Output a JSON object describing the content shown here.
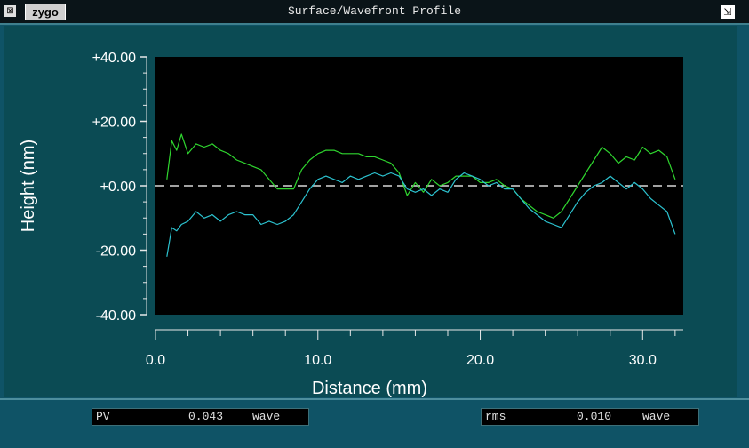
{
  "window": {
    "title": "Surface/Wavefront Profile",
    "logo": "zygo",
    "close_glyph": "⊠",
    "dock_glyph": "⇲"
  },
  "chart_data": {
    "type": "line",
    "title": "",
    "xlabel": "Distance (mm)",
    "ylabel": "Height (nm)",
    "xlim": [
      0,
      32.5
    ],
    "ylim": [
      -40,
      40
    ],
    "x_ticks": [
      0,
      10,
      20,
      30
    ],
    "x_tick_labels": [
      "0.0",
      "10.0",
      "20.0",
      "30.0"
    ],
    "y_ticks": [
      40,
      20,
      0,
      -20,
      -40
    ],
    "y_tick_labels": [
      "+40.00",
      "+20.00",
      "+0.00",
      "-20.00",
      "-40.00"
    ],
    "grid": false,
    "background": "#000000",
    "reference_line": {
      "y": 0,
      "style": "dashed",
      "color": "#d8d8d8"
    },
    "series": [
      {
        "color": "#2fd62f",
        "x": [
          0.7,
          1.0,
          1.3,
          1.6,
          2.0,
          2.5,
          3.0,
          3.5,
          4.0,
          4.5,
          5.0,
          5.5,
          6.0,
          6.5,
          7.0,
          7.5,
          8.0,
          8.5,
          9.0,
          9.5,
          10.0,
          10.5,
          11.0,
          11.5,
          12.0,
          12.5,
          13.0,
          13.5,
          14.0,
          14.5,
          15.0,
          15.5,
          16.0,
          16.5,
          17.0,
          17.5,
          18.0,
          18.5,
          19.0,
          19.5,
          20.0,
          20.5,
          21.0,
          21.5,
          22.0,
          22.5,
          23.0,
          23.5,
          24.0,
          24.5,
          25.0,
          25.5,
          26.0,
          26.5,
          27.0,
          27.5,
          28.0,
          28.5,
          29.0,
          29.5,
          30.0,
          30.5,
          31.0,
          31.5,
          32.0
        ],
        "values": [
          2,
          14,
          11,
          16,
          10,
          13,
          12,
          13,
          11,
          10,
          8,
          7,
          6,
          5,
          2,
          -1,
          -1,
          -1,
          5,
          8,
          10,
          11,
          11,
          10,
          10,
          10,
          9,
          9,
          8,
          7,
          4,
          -3,
          1,
          -2,
          2,
          0,
          1,
          3,
          3,
          3,
          1,
          1,
          2,
          0,
          -1,
          -4,
          -6,
          -8,
          -9,
          -10,
          -8,
          -4,
          0,
          4,
          8,
          12,
          10,
          7,
          9,
          8,
          12,
          10,
          11,
          9,
          2
        ]
      },
      {
        "color": "#2cc2cf",
        "x": [
          0.7,
          1.0,
          1.3,
          1.6,
          2.0,
          2.5,
          3.0,
          3.5,
          4.0,
          4.5,
          5.0,
          5.5,
          6.0,
          6.5,
          7.0,
          7.5,
          8.0,
          8.5,
          9.0,
          9.5,
          10.0,
          10.5,
          11.0,
          11.5,
          12.0,
          12.5,
          13.0,
          13.5,
          14.0,
          14.5,
          15.0,
          15.5,
          16.0,
          16.5,
          17.0,
          17.5,
          18.0,
          18.5,
          19.0,
          19.5,
          20.0,
          20.5,
          21.0,
          21.5,
          22.0,
          22.5,
          23.0,
          23.5,
          24.0,
          24.5,
          25.0,
          25.5,
          26.0,
          26.5,
          27.0,
          27.5,
          28.0,
          28.5,
          29.0,
          29.5,
          30.0,
          30.5,
          31.0,
          31.5,
          32.0
        ],
        "values": [
          -22,
          -13,
          -14,
          -12,
          -11,
          -8,
          -10,
          -9,
          -11,
          -9,
          -8,
          -9,
          -9,
          -12,
          -11,
          -12,
          -11,
          -9,
          -5,
          -1,
          2,
          3,
          2,
          1,
          3,
          2,
          3,
          4,
          3,
          4,
          3,
          -1,
          -2,
          -1,
          -3,
          -1,
          -2,
          2,
          4,
          3,
          2,
          0,
          1,
          -1,
          -1,
          -4,
          -7,
          -9,
          -11,
          -12,
          -13,
          -9,
          -5,
          -2,
          0,
          1,
          3,
          1,
          -1,
          1,
          -1,
          -4,
          -6,
          -8,
          -15
        ]
      }
    ]
  },
  "status": {
    "pv": {
      "label": "PV",
      "value": "0.043",
      "unit": "wave"
    },
    "rms": {
      "label": "rms",
      "value": "0.010",
      "unit": "wave"
    }
  }
}
